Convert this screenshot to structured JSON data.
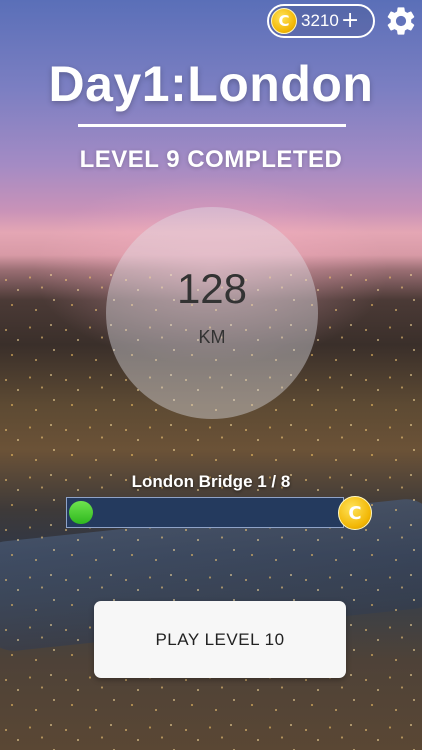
{
  "header": {
    "coins": "3210",
    "coin_symbol": "C",
    "add_label": "+"
  },
  "title": "Day1:London",
  "subtitle": "LEVEL 9 COMPLETED",
  "distance": {
    "value": "128",
    "unit": "KM"
  },
  "progress": {
    "label": "London Bridge 1 / 8",
    "current": 1,
    "total": 8,
    "coin_symbol": "C"
  },
  "play_button": {
    "label": "PLAY LEVEL 10"
  },
  "colors": {
    "progress_fill": "#2fb81f",
    "progress_track": "#243a5e",
    "coin": "#f2b705"
  },
  "icons": [
    "coin-icon",
    "plus-icon",
    "gear-icon"
  ]
}
